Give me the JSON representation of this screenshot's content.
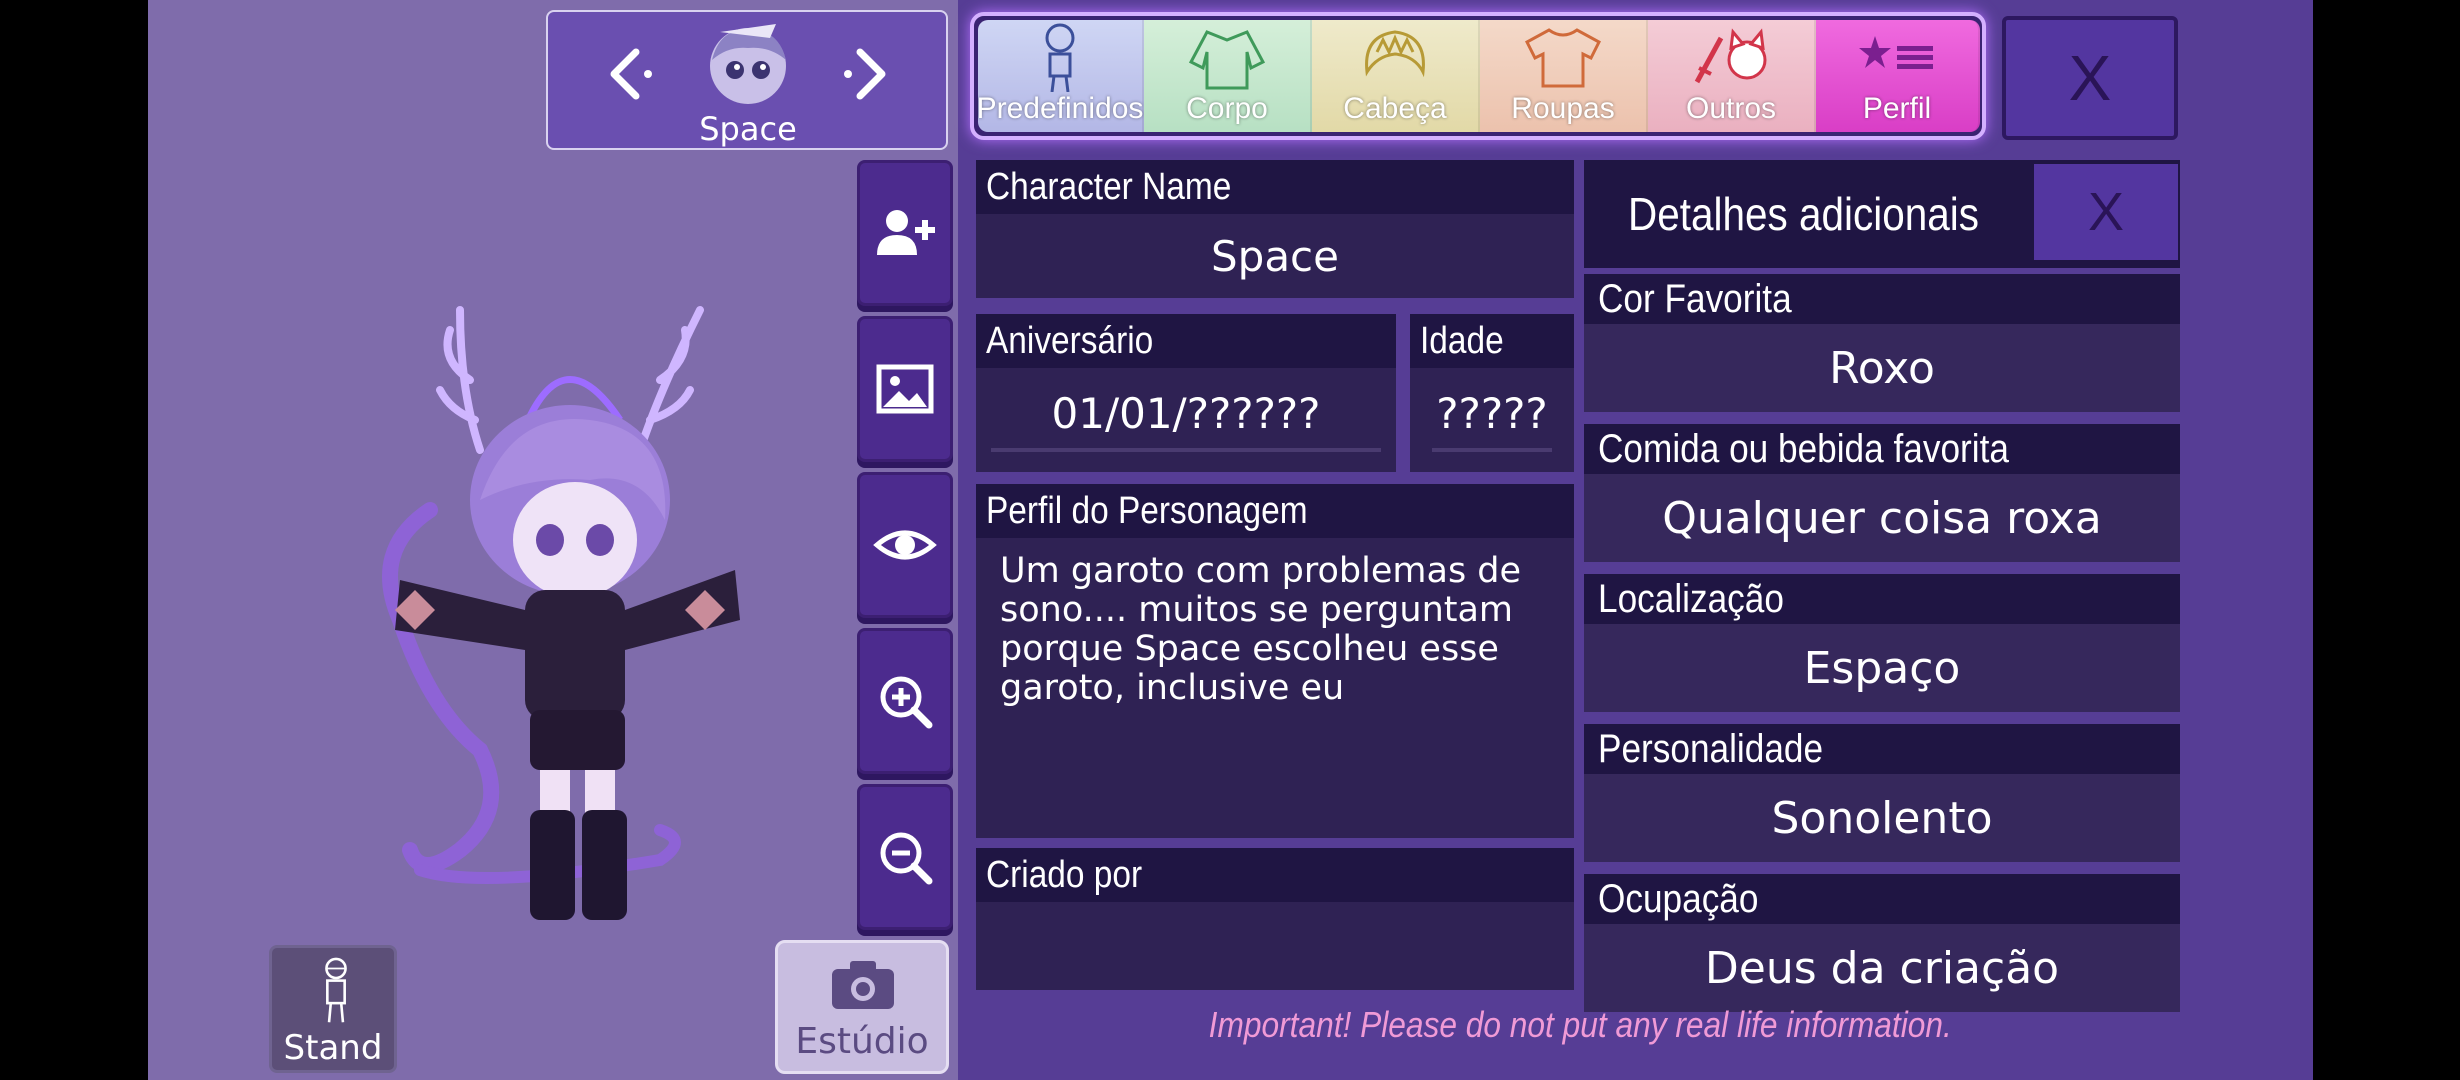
{
  "character_nav": {
    "name": "Space"
  },
  "tabs": [
    {
      "id": "predefinidos",
      "label": "Predefinidos"
    },
    {
      "id": "corpo",
      "label": "Corpo"
    },
    {
      "id": "cabeca",
      "label": "Cabeça"
    },
    {
      "id": "roupas",
      "label": "Roupas"
    },
    {
      "id": "outros",
      "label": "Outros"
    },
    {
      "id": "perfil",
      "label": "Perfil"
    }
  ],
  "close_label": "X",
  "profile": {
    "name_label": "Character Name",
    "name_value": "Space",
    "birthday_label": "Aniversário",
    "birthday_value": "01/01/??????",
    "age_label": "Idade",
    "age_value": "?????",
    "bio_label": "Perfil do Personagem",
    "bio_value": "Um garoto com problemas de sono.... muitos se perguntam porque Space escolheu esse garoto, inclusive eu",
    "created_by_label": "Criado por",
    "created_by_value": ""
  },
  "details": {
    "title": "Detalhes adicionais",
    "close_label": "X",
    "items": [
      {
        "label": "Cor Favorita",
        "value": "Roxo"
      },
      {
        "label": "Comida ou bebida favorita",
        "value": "Qualquer coisa roxa"
      },
      {
        "label": "Localização",
        "value": "Espaço"
      },
      {
        "label": "Personalidade",
        "value": "Sonolento"
      },
      {
        "label": "Ocupação",
        "value": "Deus da criação"
      }
    ]
  },
  "warning": "Important! Please do not put any real life information.",
  "bottom": {
    "stand_label": "Stand",
    "studio_label": "Estúdio"
  },
  "icons": [
    "chevron-left-icon",
    "chevron-right-icon",
    "add-user-icon",
    "image-icon",
    "eye-icon",
    "zoom-in-icon",
    "zoom-out-icon",
    "camera-icon",
    "stand-pose-icon"
  ],
  "colors": {
    "panel_bg": "#563d95",
    "left_bg": "#7f6cab",
    "active_tab": "#e54fd3",
    "dark_field": "#1f1543"
  }
}
